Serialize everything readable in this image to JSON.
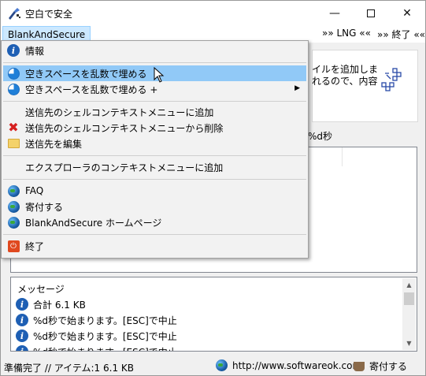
{
  "window": {
    "title": "空白で安全"
  },
  "menubar": {
    "main": "BlankAndSecure",
    "lng": "»» LNG ««",
    "exit": "»» 終了 ««"
  },
  "menu": {
    "items": [
      {
        "label": "情報",
        "icon": "info-icon"
      },
      {
        "label": "空きスペースを乱数で埋める",
        "icon": "pie-icon",
        "highlighted": true
      },
      {
        "label": "空きスペースを乱数で埋める +",
        "icon": "pie-icon",
        "submenu": true
      },
      {
        "label": "送信先のシェルコンテキストメニューに追加",
        "icon": ""
      },
      {
        "label": "送信先のシェルコンテキストメニューから削除",
        "icon": "red-x-icon"
      },
      {
        "label": "送信先を編集",
        "icon": "folder-icon"
      },
      {
        "label": "エクスプローラのコンテキストメニューに追加",
        "icon": ""
      },
      {
        "label": "FAQ",
        "icon": "globe-icon"
      },
      {
        "label": "寄付する",
        "icon": "globe-icon"
      },
      {
        "label": "BlankAndSecure ホームページ",
        "icon": "globe-icon"
      },
      {
        "label": "終了",
        "icon": "power-icon"
      }
    ],
    "submenu_arrow": "▶"
  },
  "info_panel": {
    "line1": "イルを追加しま",
    "line2": "れるので、内容"
  },
  "time_label": "%d秒",
  "messages": {
    "title": "メッセージ",
    "lines": [
      "合計 6.1 KB",
      "%d秒で始まります。[ESC]で中止",
      "%d秒で始まります。[ESC]で中止",
      "%d秒で始まります。[ESC]で中止"
    ]
  },
  "status": {
    "left": "準備完了 // アイテム:1 6.1 KB",
    "url": "http://www.softwareok.com",
    "donate": "寄付する"
  },
  "colors": {
    "highlight": "#91c9f7",
    "menubar_active": "#cce8ff",
    "info_blue": "#1e5fb4"
  }
}
